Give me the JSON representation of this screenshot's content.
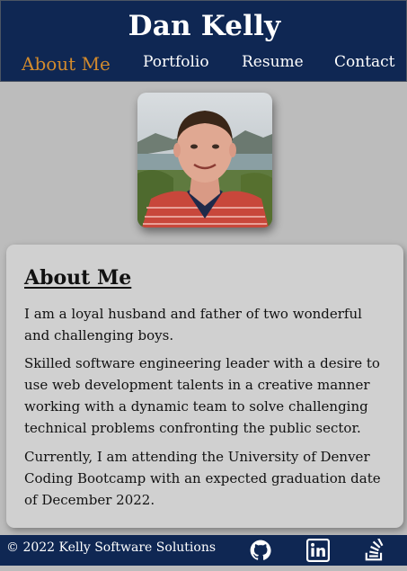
{
  "header": {
    "title": "Dan Kelly",
    "nav": [
      {
        "label": "About Me",
        "active": true
      },
      {
        "label": "Portfolio",
        "active": false
      },
      {
        "label": "Resume",
        "active": false
      },
      {
        "label": "Contact",
        "active": false
      }
    ]
  },
  "profile": {
    "photo_icon": "profile-photo"
  },
  "about": {
    "heading": "About Me",
    "paragraphs": [
      "I am a loyal husband and father of two wonderful and challenging boys.",
      "Skilled software engineering leader with a desire to use web development talents in a creative manner working with a dynamic team to solve challenging technical problems confronting the public sector.",
      "Currently, I am attending the University of Denver Coding Bootcamp with an expected graduation date of December 2022."
    ]
  },
  "footer": {
    "copyright": "© 2022 Kelly Software Solutions",
    "icons": [
      "github-icon",
      "linkedin-icon",
      "stackoverflow-icon"
    ]
  },
  "colors": {
    "header_bg": "#0f2753",
    "accent": "#d18a2d",
    "page_bg": "#bcbcbc",
    "card_bg": "#d0d0d0"
  }
}
